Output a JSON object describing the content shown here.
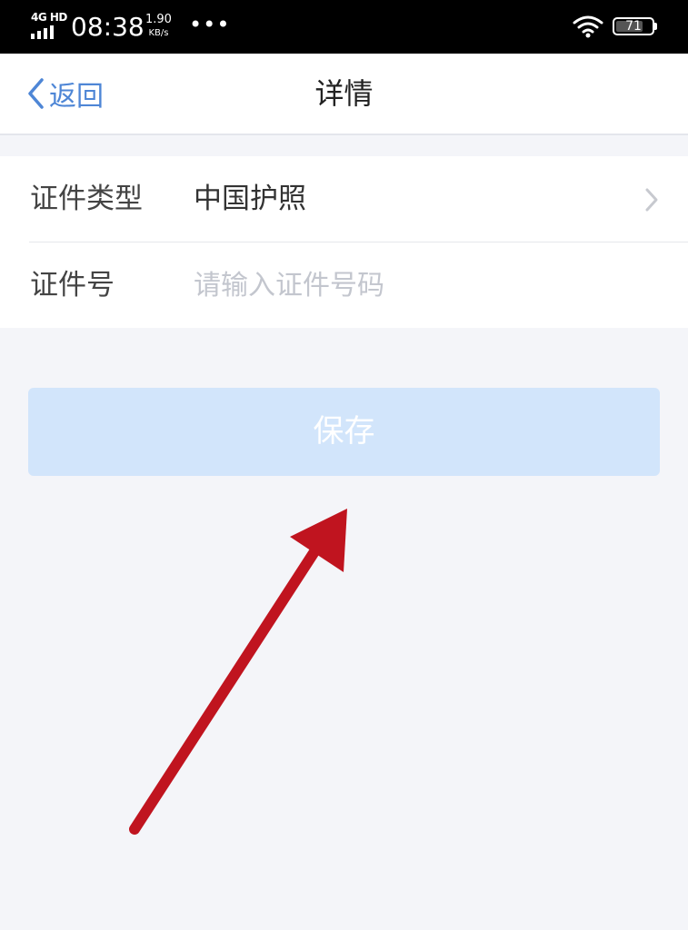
{
  "status_bar": {
    "network": "4G HD",
    "time": "08:38",
    "speed_value": "1.90",
    "speed_unit": "KB/s",
    "dots": "•••",
    "battery": "71"
  },
  "nav": {
    "back_label": "返回",
    "title": "详情"
  },
  "form": {
    "type_label": "证件类型",
    "type_value": "中国护照",
    "number_label": "证件号",
    "number_value": "",
    "number_placeholder": "请输入证件号码"
  },
  "save_button": {
    "label": "保存"
  },
  "colors": {
    "accent": "#4e86d6",
    "button_bg": "#d2e5fb",
    "page_bg": "#f4f5f9",
    "annotation_arrow": "#c0141f"
  }
}
